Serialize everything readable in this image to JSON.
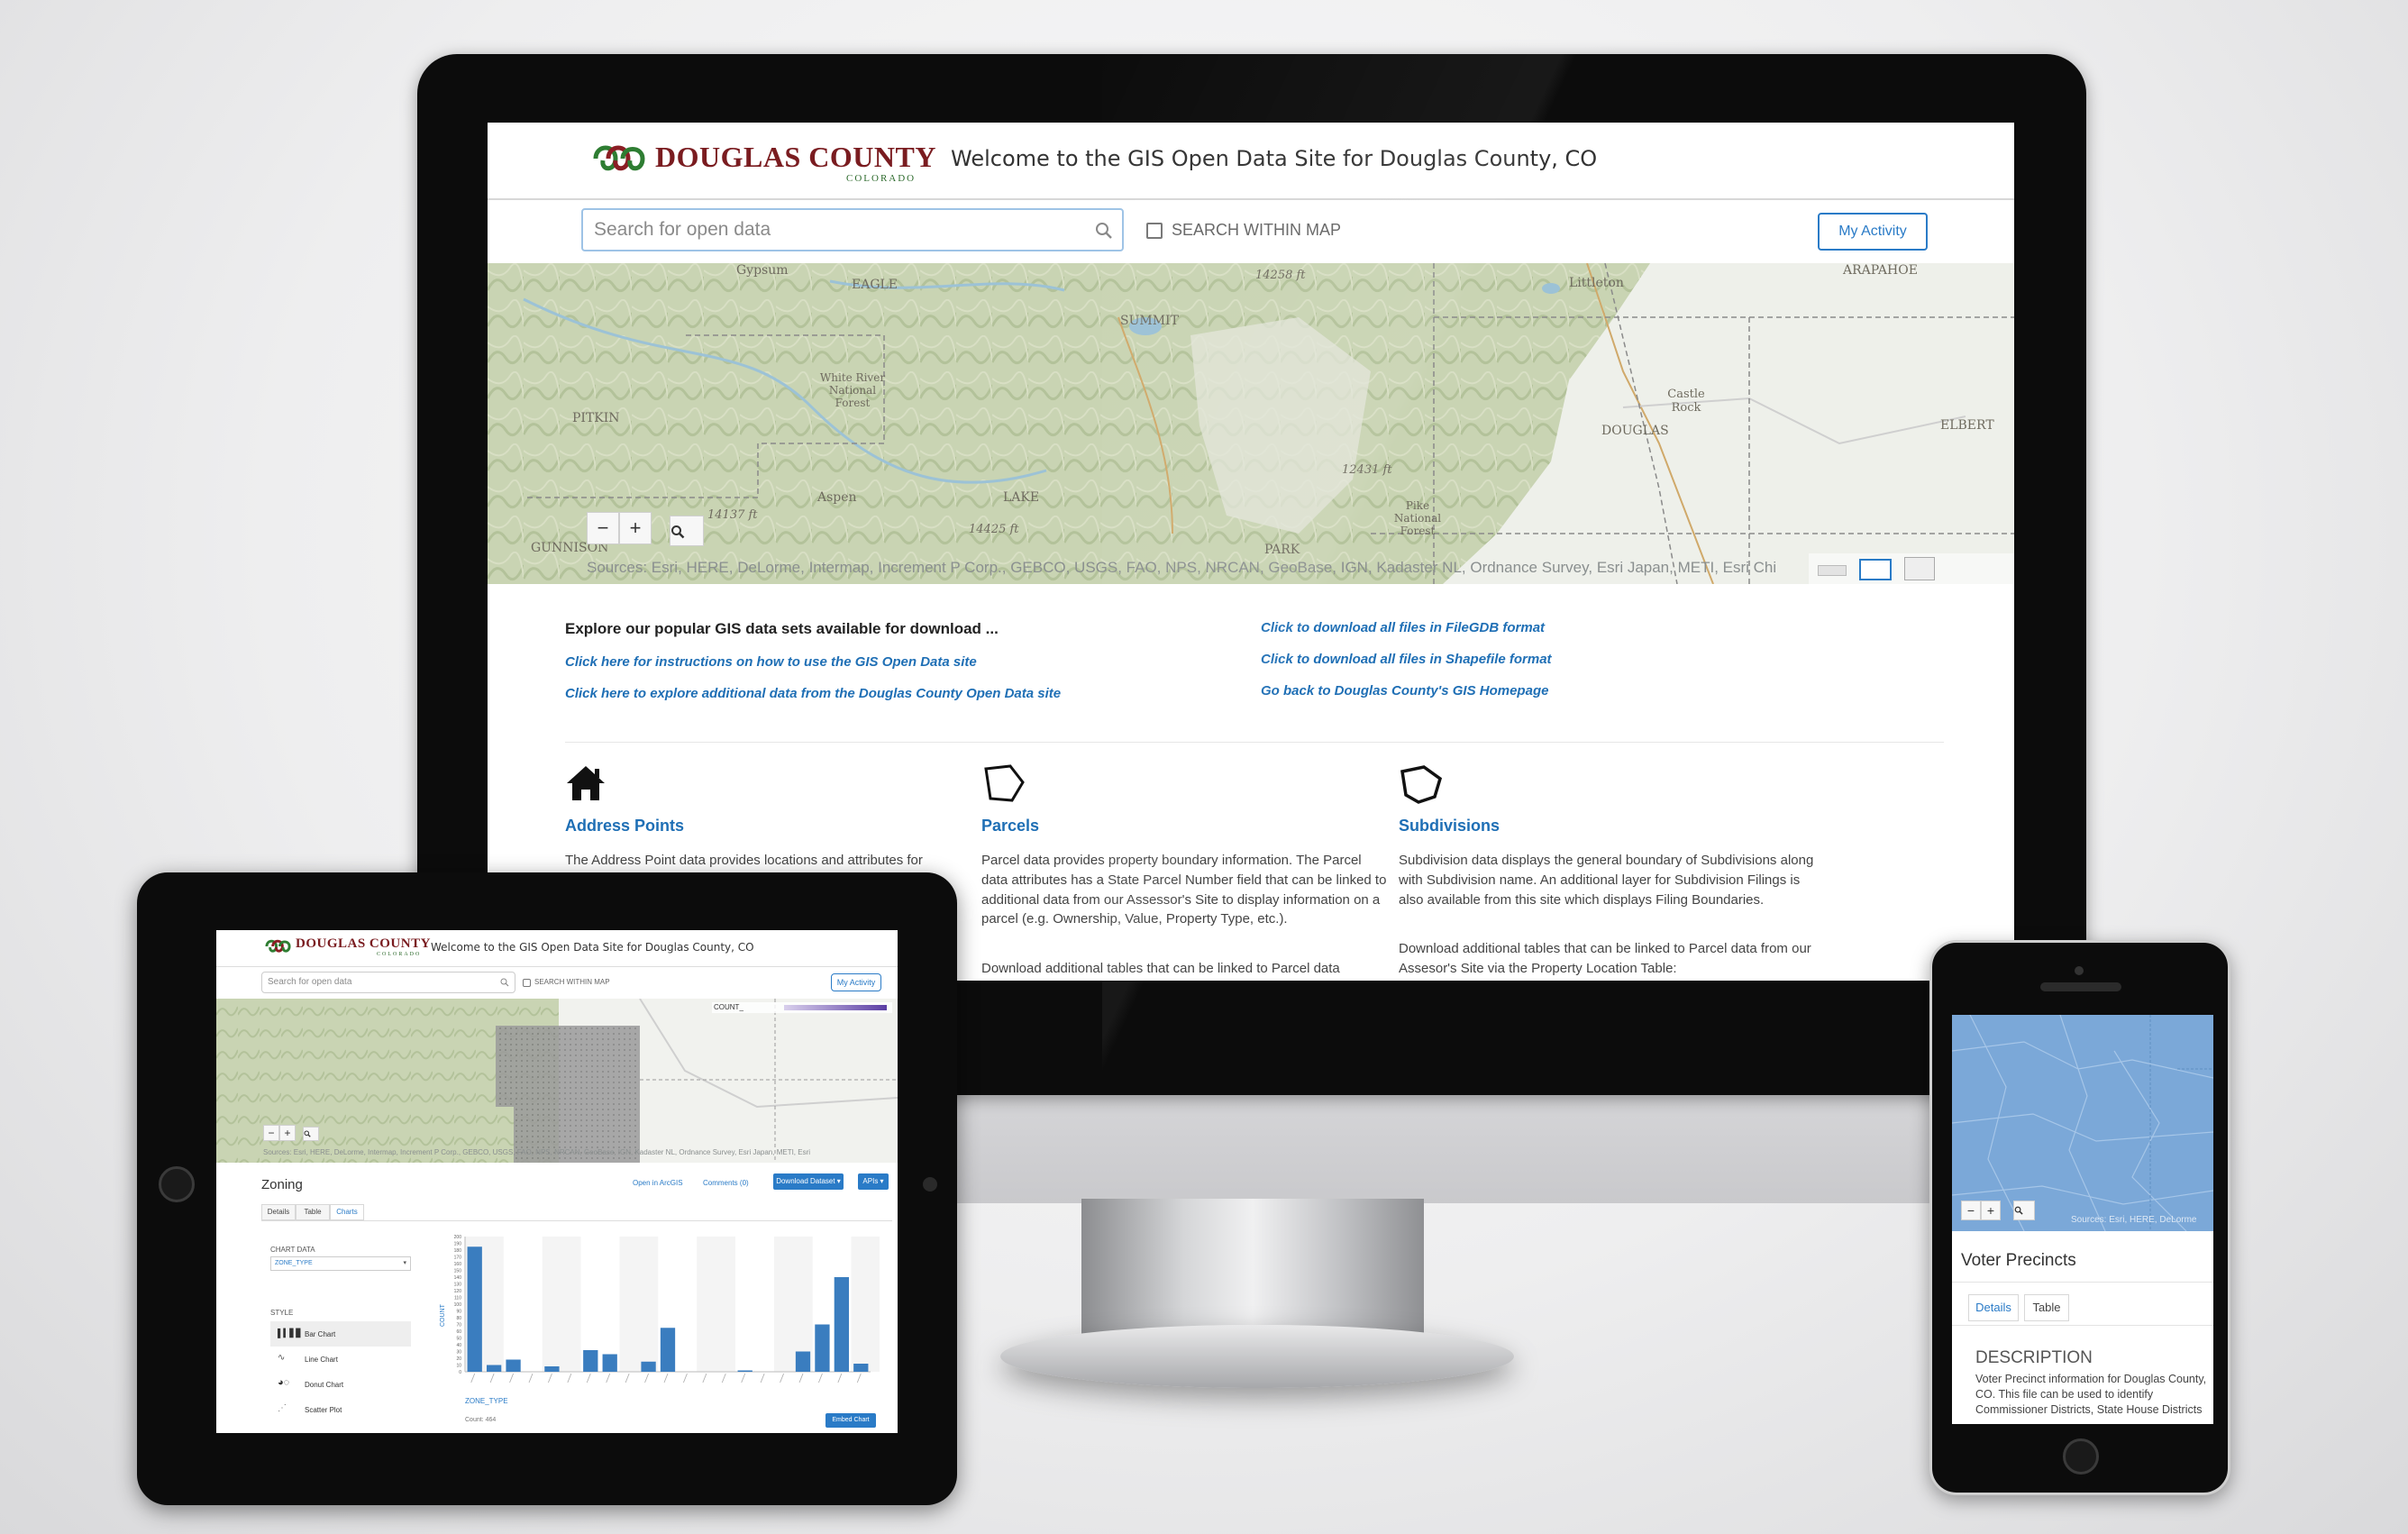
{
  "desktop": {
    "header": {
      "logo_text": "DOUGLAS COUNTY",
      "logo_sub": "COLORADO",
      "title": "Welcome to the GIS Open Data Site for Douglas County, CO"
    },
    "search": {
      "placeholder": "Search for open data",
      "within_map_label": "SEARCH WITHIN MAP",
      "my_activity": "My Activity"
    },
    "map": {
      "labels": [
        "Gypsum",
        "EAGLE",
        "SUMMIT",
        "14258 ft",
        "Littleton",
        "ARAPAHOE",
        "White River National Forest",
        "PITKIN",
        "Castle Rock",
        "DOUGLAS",
        "ELBERT",
        "12431 ft",
        "Aspen",
        "LAKE",
        "14137 ft",
        "Pike National Forest",
        "14425 ft",
        "GUNNISON",
        "PARK"
      ],
      "zoom_out": "−",
      "zoom_in": "+",
      "attribution": "Sources: Esri, HERE, DeLorme, Intermap, Increment P Corp., GEBCO, USGS, FAO, NPS, NRCAN, GeoBase, IGN, Kadaster NL, Ordnance Survey, Esri Japan, METI, Esri Chi"
    },
    "intro": {
      "heading": "Explore our popular GIS data sets available for download ...",
      "left_links": [
        "Click here for instructions on how to use the GIS Open Data site",
        "Click here to explore additional data from the Douglas County Open Data site"
      ],
      "right_links": [
        "Click to download all files in FileGDB format",
        "Click to download all files in Shapefile format",
        "Go back to Douglas County's GIS Homepage"
      ]
    },
    "categories": [
      {
        "title": "Address Points",
        "icon": "house-icon",
        "text": "The Address Point data provides locations and attributes for"
      },
      {
        "title": "Parcels",
        "icon": "parcel-polygon-icon",
        "text": "Parcel data provides property boundary information. The Parcel data attributes has a State Parcel Number field that can be linked to additional data from our Assessor's Site to display information on a parcel (e.g. Ownership, Value, Property Type, etc.).",
        "text2": "Download additional tables that can be linked to Parcel data"
      },
      {
        "title": "Subdivisions",
        "icon": "subdivision-polygon-icon",
        "text": "Subdivision data displays the general boundary of Subdivisions along with Subdivision name. An additional layer for Subdivision Filings is also available from this site which displays Filing Boundaries.",
        "text2": "Download additional tables that can be linked to Parcel data from our Assesor's Site via the Property Location Table:"
      }
    ]
  },
  "tablet": {
    "header": {
      "logo_text": "DOUGLAS COUNTY",
      "logo_sub": "COLORADO",
      "title": "Welcome to the GIS Open Data Site for Douglas County, CO"
    },
    "search_placeholder": "Search for open data",
    "within_map_label": "SEARCH WITHIN MAP",
    "my_activity": "My Activity",
    "map_select": "COUNT_",
    "map_attribution": "Sources: Esri, HERE, DeLorme, Intermap, Increment P Corp., GEBCO, USGS, FAO, NPS, NRCAN, GeoBase, IGN, Kadaster NL, Ordnance Survey, Esri Japan, METI, Esri",
    "dataset_title": "Zoning",
    "actions": {
      "open_arcgis": "Open in ArcGIS",
      "comments": "Comments (0)",
      "download": "Download Dataset ▾",
      "apis": "APIs ▾"
    },
    "tabs": [
      "Details",
      "Table",
      "Charts"
    ],
    "active_tab": "Charts",
    "chart_data_label": "CHART DATA",
    "chart_field": "ZONE_TYPE",
    "style_label": "STYLE",
    "styles": [
      "Bar Chart",
      "Line Chart",
      "Donut Chart",
      "Scatter Plot"
    ],
    "selected_style": "Bar Chart",
    "embed_button": "Embed Chart",
    "count_footer": "Count: 464"
  },
  "chart_data": {
    "type": "bar",
    "xlabel": "ZONE_TYPE",
    "ylabel": "COUNT",
    "ylim": [
      0,
      200
    ],
    "y_ticks": [
      0,
      10,
      20,
      30,
      40,
      50,
      60,
      70,
      80,
      90,
      100,
      110,
      120,
      130,
      140,
      150,
      160,
      170,
      180,
      190,
      200
    ],
    "values": [
      185,
      10,
      18,
      0,
      8,
      0,
      32,
      26,
      0,
      15,
      65,
      0,
      0,
      0,
      2,
      0,
      0,
      30,
      70,
      140,
      12
    ]
  },
  "phone": {
    "zoom_out": "−",
    "zoom_in": "+",
    "attribution": "Sources: Esri, HERE, DeLorme",
    "title": "Voter Precincts",
    "tabs": [
      "Details",
      "Table"
    ],
    "active_tab": "Details",
    "description_heading": "DESCRIPTION",
    "description": "Voter Precinct information for Douglas County, CO. This file can be used to identify Commissioner Districts, State House Districts"
  }
}
